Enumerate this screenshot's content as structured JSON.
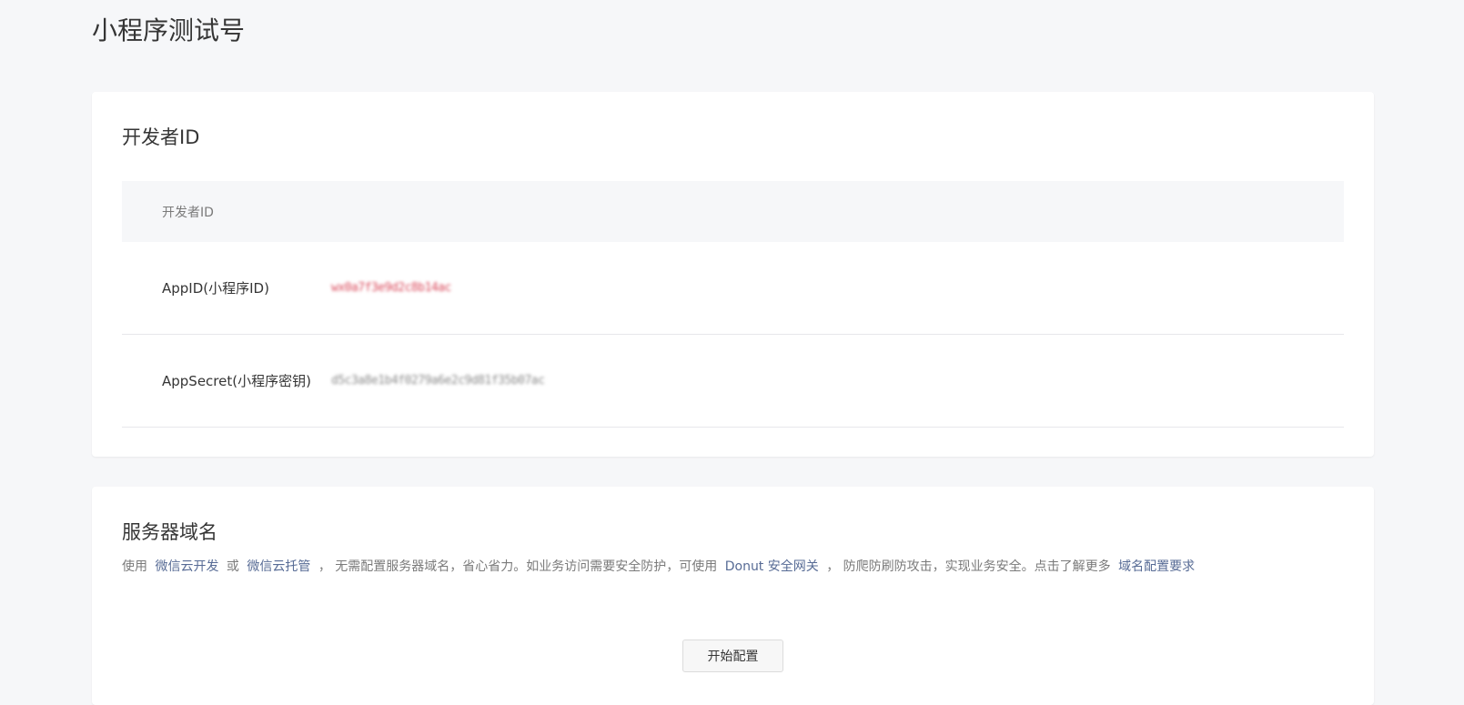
{
  "page": {
    "title": "小程序测试号"
  },
  "developer_card": {
    "title": "开发者ID",
    "table_header": "开发者ID",
    "rows": [
      {
        "label": "AppID(小程序ID)",
        "value": "wx0a7f3e9d2c8b14ac"
      },
      {
        "label": "AppSecret(小程序密钥)",
        "value": "d5c3a8e1b4f0279a6e2c9d81f35b07ac"
      }
    ]
  },
  "server_card": {
    "title": "服务器域名",
    "desc_prefix": "使用",
    "link_cloud_dev": "微信云开发",
    "desc_or": "或",
    "link_cloud_host": "微信云托管",
    "desc_mid": "， 无需配置服务器域名，省心省力。如业务访问需要安全防护，可使用",
    "link_donut": "Donut 安全网关",
    "desc_tail": "， 防爬防刷防攻击，实现业务安全。点击了解更多",
    "link_domain_req": "域名配置要求",
    "start_button": "开始配置"
  },
  "colors": {
    "link": "#576b95",
    "background": "#f6f7f9",
    "appid_value": "#d9485a"
  }
}
